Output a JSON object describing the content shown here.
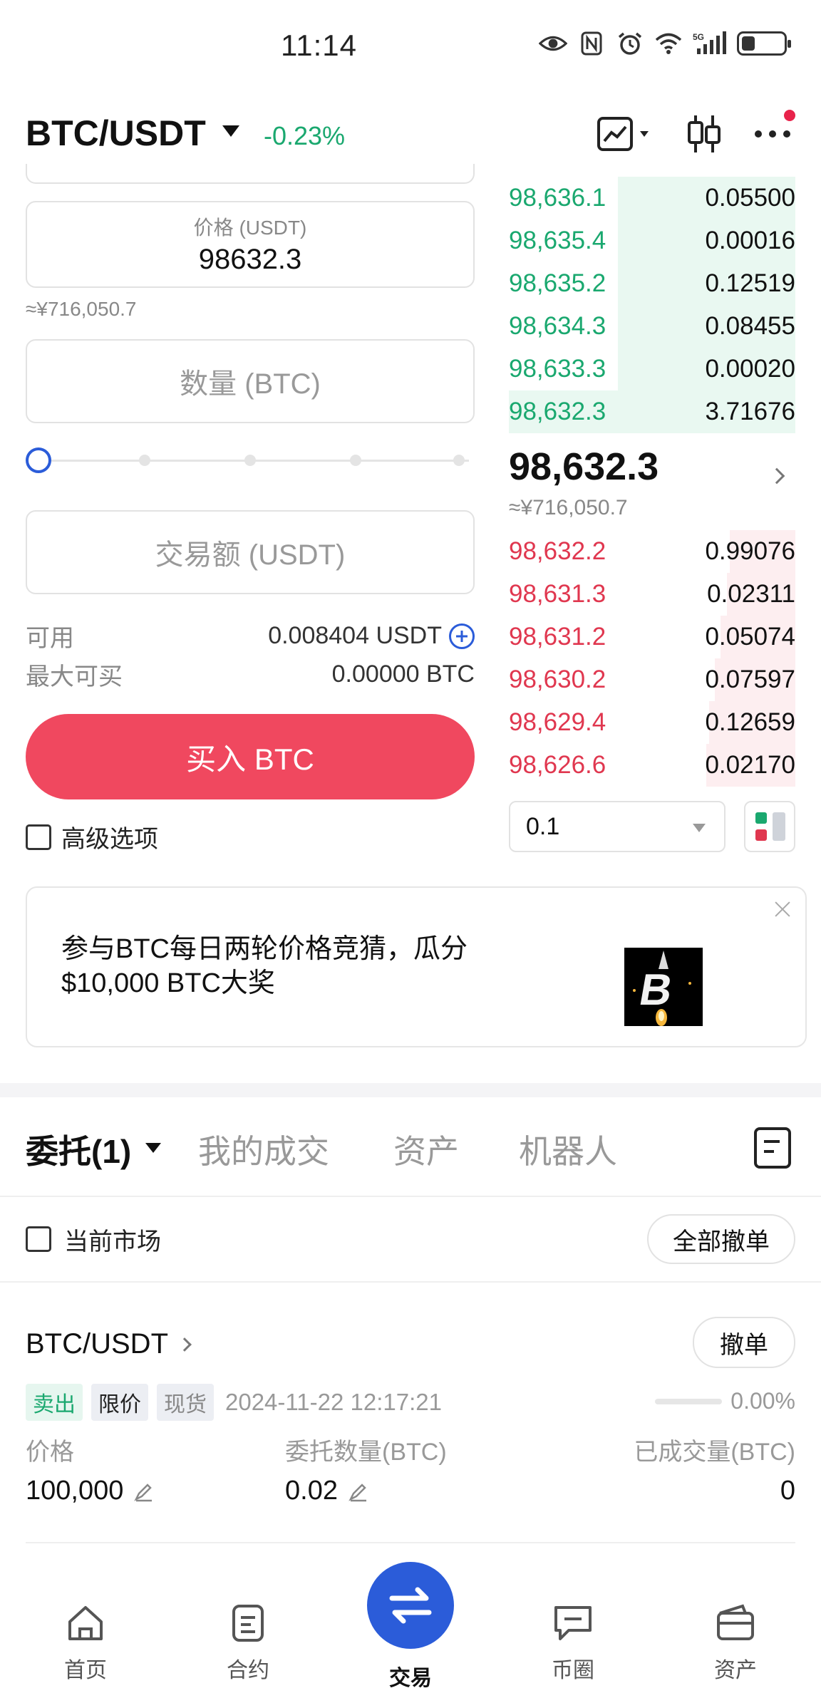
{
  "status_bar": {
    "time": "11:14",
    "network": "5G"
  },
  "header": {
    "pair": "BTC/USDT",
    "change": "-0.23%"
  },
  "form": {
    "price_label": "价格 (USDT)",
    "price_value": "98632.3",
    "price_approx": "≈¥716,050.7",
    "qty_placeholder": "数量 (BTC)",
    "amount_placeholder": "交易额 (USDT)",
    "slider_percent": 0,
    "available_label": "可用",
    "available_value": "0.008404 USDT",
    "max_buy_label": "最大可买",
    "max_buy_value": "0.00000 BTC",
    "buy_button": "买入 BTC",
    "advanced_label": "高级选项"
  },
  "orderbook": {
    "asks": [
      {
        "price": "98,636.1",
        "qty": "0.05500",
        "depth": 0.62
      },
      {
        "price": "98,635.4",
        "qty": "0.00016",
        "depth": 0.62
      },
      {
        "price": "98,635.2",
        "qty": "0.12519",
        "depth": 0.62
      },
      {
        "price": "98,634.3",
        "qty": "0.08455",
        "depth": 0.62
      },
      {
        "price": "98,633.3",
        "qty": "0.00020",
        "depth": 0.62
      },
      {
        "price": "98,632.3",
        "qty": "3.71676",
        "depth": 1.0
      }
    ],
    "mid_price": "98,632.3",
    "mid_approx": "≈¥716,050.7",
    "bids": [
      {
        "price": "98,632.2",
        "qty": "0.99076",
        "depth": 0.23
      },
      {
        "price": "98,631.3",
        "qty": "0.02311",
        "depth": 0.24
      },
      {
        "price": "98,631.2",
        "qty": "0.05074",
        "depth": 0.26
      },
      {
        "price": "98,630.2",
        "qty": "0.07597",
        "depth": 0.28
      },
      {
        "price": "98,629.4",
        "qty": "0.12659",
        "depth": 0.3
      },
      {
        "price": "98,626.6",
        "qty": "0.02170",
        "depth": 0.31
      }
    ],
    "depth_value": "0.1"
  },
  "promo": {
    "text": "参与BTC每日两轮价格竞猜，瓜分$10,000 BTC大奖"
  },
  "orders": {
    "tabs": [
      "委托(1)",
      "我的成交",
      "资产",
      "机器人"
    ],
    "current_market_label": "当前市场",
    "cancel_all": "全部撤单",
    "items": [
      {
        "pair": "BTC/USDT",
        "cancel": "撤单",
        "side": "卖出",
        "order_type": "限价",
        "market": "现货",
        "time": "2024-11-22 12:17:21",
        "filled_percent": "0.00%",
        "price_label": "价格",
        "price": "100,000",
        "qty_label": "委托数量(BTC)",
        "qty": "0.02",
        "filled_label": "已成交量(BTC)",
        "filled": "0"
      }
    ]
  },
  "bottom_nav": {
    "home": "首页",
    "futures": "合约",
    "trade": "交易",
    "community": "币圈",
    "assets": "资产"
  },
  "colors": {
    "green": "#1aa86f",
    "red": "#e0374f",
    "buy": "#f0485f",
    "accent": "#2b5cd9"
  }
}
